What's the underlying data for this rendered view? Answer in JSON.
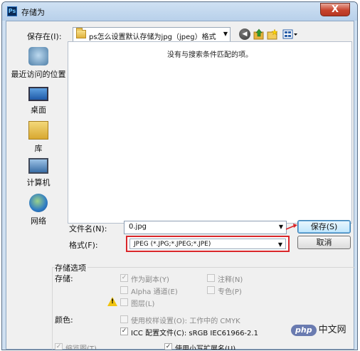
{
  "window": {
    "app_icon_text": "Ps",
    "title": "存储为",
    "close_glyph": "X"
  },
  "header": {
    "save_in_label": "保存在(I):",
    "save_in_value": "ps怎么设置默认存储为jpg（jpeg）格式",
    "combo_arrow": "▼"
  },
  "places": [
    {
      "label": "最近访问的位置",
      "icon": "recent-places-icon"
    },
    {
      "label": "桌面",
      "icon": "desktop-icon"
    },
    {
      "label": "库",
      "icon": "library-icon"
    },
    {
      "label": "计算机",
      "icon": "computer-icon"
    },
    {
      "label": "网络",
      "icon": "network-icon"
    }
  ],
  "file_list": {
    "empty_message": "没有与搜索条件匹配的项。"
  },
  "filename": {
    "label": "文件名(N):",
    "value": "0.jpg"
  },
  "format": {
    "label": "格式(F):",
    "value": "JPEG (*.JPG;*.JPEG;*.JPE)"
  },
  "buttons": {
    "save": "保存(S)",
    "cancel": "取消"
  },
  "options": {
    "title": "存储选项",
    "save_label": "存储:",
    "color_label": "颜色:",
    "as_copy": {
      "label": "作为副本(Y)",
      "checked": true,
      "enabled": false
    },
    "alpha": {
      "label": "Alpha 通道(E)",
      "checked": false,
      "enabled": false
    },
    "layers": {
      "label": "图层(L)",
      "checked": false,
      "enabled": false
    },
    "notes": {
      "label": "注释(N)",
      "checked": false,
      "enabled": false
    },
    "spot": {
      "label": "专色(P)",
      "checked": false,
      "enabled": false
    },
    "proof": {
      "label": "使用校样设置(O): 工作中的 CMYK",
      "checked": false,
      "enabled": false
    },
    "icc": {
      "label": "ICC 配置文件(C): sRGB IEC61966-2.1",
      "checked": true,
      "enabled": true
    },
    "thumbnail": {
      "label": "缩览图(T)",
      "checked": true,
      "enabled": false
    },
    "lowercase_ext": {
      "label": "使用小写扩展名(U)",
      "checked": true,
      "enabled": true
    }
  },
  "watermark": {
    "badge": "php",
    "text": "中文网"
  },
  "colors": {
    "highlight_border": "#d9262a",
    "title_bar": "#b8d0ea",
    "close_button": "#c7432c"
  }
}
